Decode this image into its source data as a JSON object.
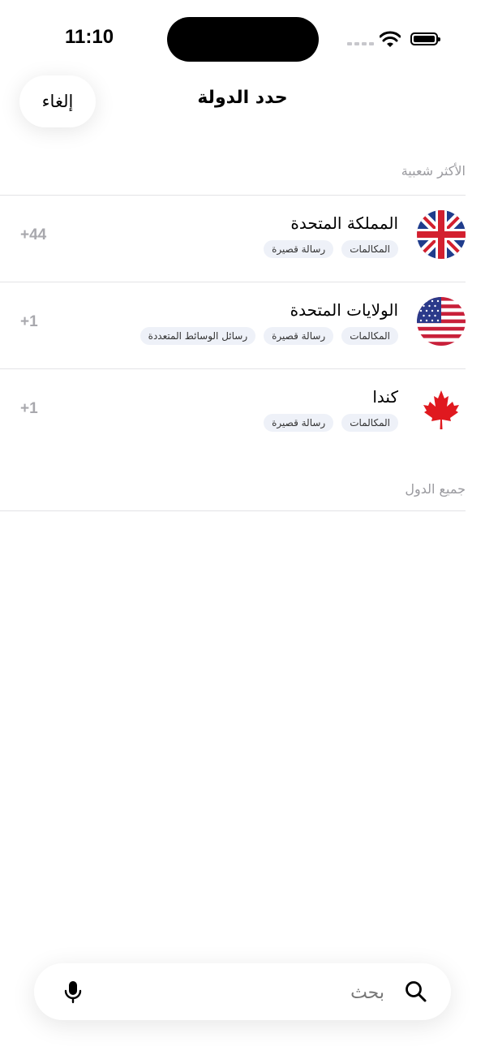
{
  "status_bar": {
    "time": "11:10"
  },
  "nav": {
    "cancel_label": "إلغاء",
    "title": "حدد الدولة"
  },
  "sections": {
    "popular": "الأكثر شعبية",
    "all": "جميع الدول"
  },
  "countries": [
    {
      "name": "المملكة المتحدة",
      "code": "+44",
      "flag": "uk-flag-icon",
      "tags": [
        "المكالمات",
        "رسالة قصيرة"
      ]
    },
    {
      "name": "الولايات المتحدة",
      "code": "+1",
      "flag": "us-flag-icon",
      "tags": [
        "المكالمات",
        "رسالة قصيرة",
        "رسائل الوسائط المتعددة"
      ]
    },
    {
      "name": "كندا",
      "code": "+1",
      "flag": "canada-flag-icon",
      "tags": [
        "المكالمات",
        "رسالة قصيرة"
      ]
    }
  ],
  "search": {
    "placeholder": "بحث"
  },
  "colors": {
    "accent_text": "#000000",
    "muted": "#9a9a9f",
    "tag_bg": "#eef1f8"
  }
}
